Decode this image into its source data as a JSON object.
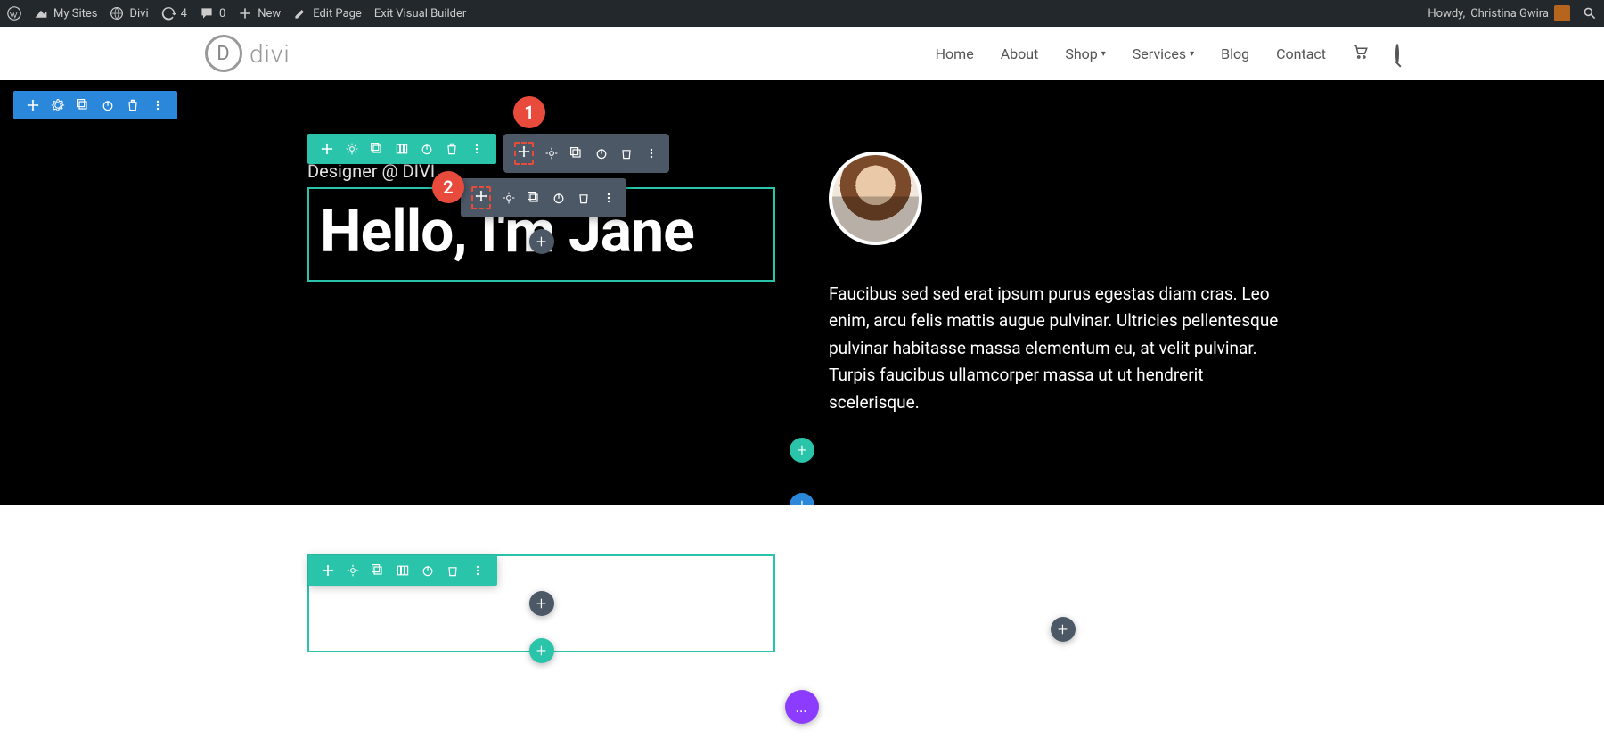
{
  "adminbar": {
    "mysites": "My Sites",
    "sitename": "Divi",
    "updates": "4",
    "comments": "0",
    "new": "New",
    "editpage": "Edit Page",
    "exitvb": "Exit Visual Builder",
    "howdy_prefix": "Howdy, ",
    "username": "Christina Gwira"
  },
  "nav": {
    "logo": "divi",
    "home": "Home",
    "about": "About",
    "shop": "Shop",
    "services": "Services",
    "blog": "Blog",
    "contact": "Contact"
  },
  "hero": {
    "subtitle": "Designer @ DIVI",
    "heading": "Hello, I'm Jane",
    "paragraph": "Faucibus sed sed erat ipsum purus egestas diam cras. Leo enim, arcu felis mattis augue pulvinar. Ultricies pellentesque pulvinar habitasse massa elementum eu, at velit pulvinar. Turpis faucibus ullamcorper massa ut ut hendrerit scelerisque."
  },
  "annotations": {
    "a1": "1",
    "a2": "2"
  },
  "add": "+",
  "more": "…"
}
